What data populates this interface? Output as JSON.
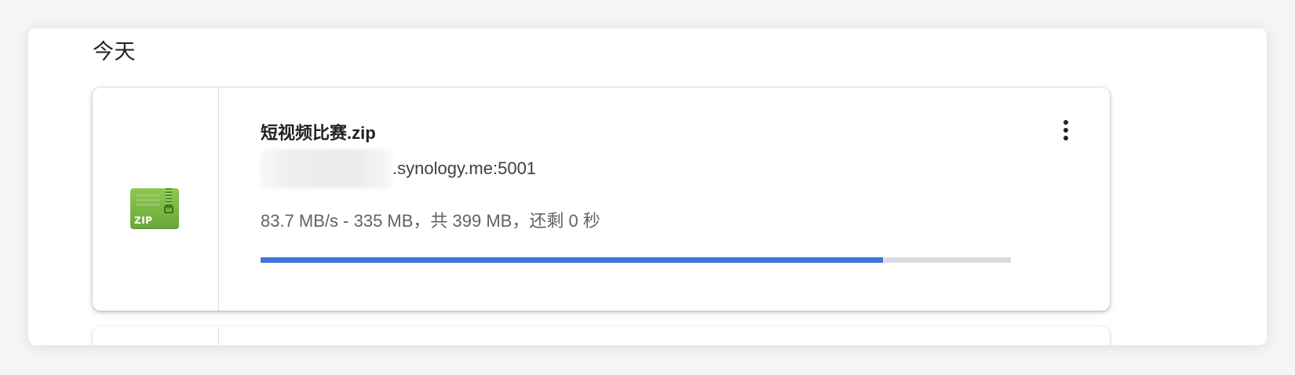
{
  "section": {
    "title": "今天"
  },
  "download": {
    "file_name": "短视频比赛.zip",
    "source_domain": ".synology.me:5001",
    "status": "83.7 MB/s - 335 MB，共 399 MB，还剩 0 秒",
    "progress_fraction": 0.829,
    "file_type_badge": "ZIP",
    "icon": "zip-archive-icon",
    "more_icon": "more-vert-icon"
  },
  "colors": {
    "progress_fill": "#3c78d8",
    "progress_track": "#dadce0",
    "zip_icon_green": "#7cb946"
  }
}
